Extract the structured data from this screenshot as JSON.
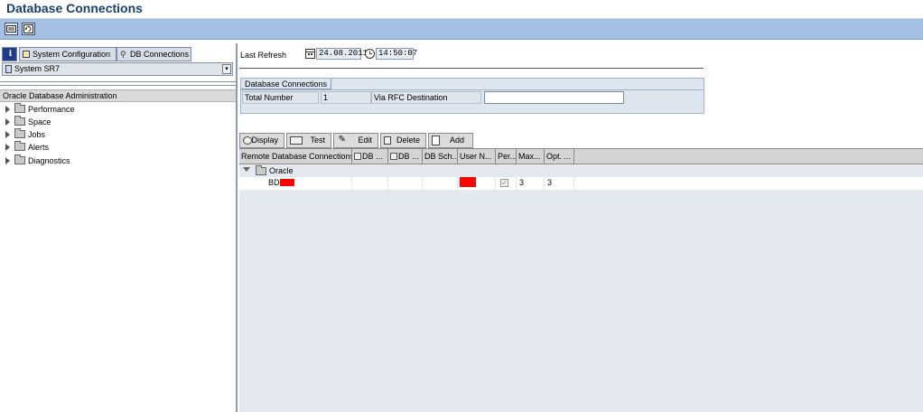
{
  "window": {
    "title": "Database Connections"
  },
  "toolbar": {
    "icons": [
      "display-icon",
      "refresh-icon"
    ]
  },
  "sidebar": {
    "tabs": [
      {
        "label": "",
        "icon": "info-icon"
      },
      {
        "label": "System Configuration",
        "icon": "config-icon"
      },
      {
        "label": "DB Connections",
        "icon": "link-icon"
      }
    ],
    "system_selector": "System SR7",
    "tree_header": "Oracle Database Administration",
    "tree_items": [
      {
        "label": "Performance"
      },
      {
        "label": "Space"
      },
      {
        "label": "Jobs"
      },
      {
        "label": "Alerts"
      },
      {
        "label": "Diagnostics"
      }
    ]
  },
  "main": {
    "last_refresh_label": "Last Refresh",
    "last_refresh_date": "24.08.2011",
    "last_refresh_time": "14:50:07",
    "group_title": "Database Connections",
    "total_number_label": "Total Number",
    "total_number_value": "1",
    "rfc_label": "Via RFC Destination",
    "rfc_value": "",
    "buttons": {
      "display": "Display",
      "test": "Test",
      "edit": "Edit",
      "delete": "Delete",
      "add": "Add"
    },
    "grid": {
      "columns": [
        "Remote Database Connections",
        "DB ...",
        "DB ...",
        "DB Sch...",
        "User N...",
        "Per...",
        "Max...",
        "Opt. ..."
      ],
      "group_label": "Oracle",
      "rows": [
        {
          "name": "BD",
          "user": "",
          "persistent": "✓",
          "max": "3",
          "opt": "3"
        }
      ]
    }
  }
}
